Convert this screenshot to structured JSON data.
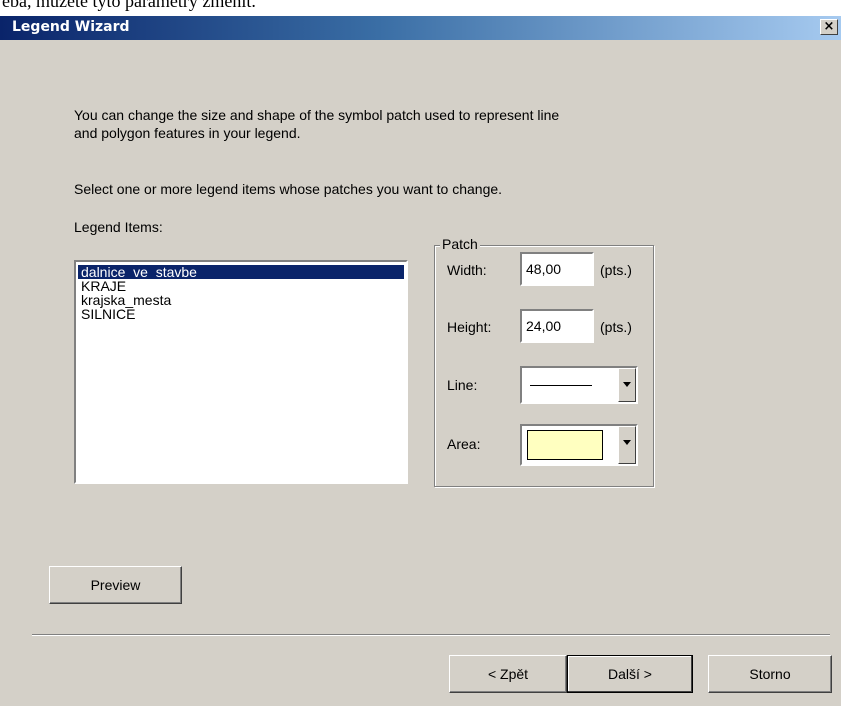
{
  "background_doc_text": "eba, můžete tyto parametry změnit.",
  "window": {
    "title": "Legend Wizard",
    "close_symbol": "×"
  },
  "instructions": {
    "line1": "You can change the size and shape of the symbol patch used to represent line",
    "line2": "and polygon features in your legend.",
    "select_prompt": "Select one or more legend items whose patches you want to change."
  },
  "legend_items": {
    "label": "Legend Items:",
    "items": [
      {
        "label": "dalnice_ve_stavbe",
        "selected": true
      },
      {
        "label": "KRAJE",
        "selected": false
      },
      {
        "label": "krajska_mesta",
        "selected": false
      },
      {
        "label": "SILNICE",
        "selected": false
      }
    ]
  },
  "patch": {
    "group_label": "Patch",
    "width_label": "Width:",
    "width_value": "48,00",
    "width_unit": "(pts.)",
    "height_label": "Height:",
    "height_value": "24,00",
    "height_unit": "(pts.)",
    "line_label": "Line:",
    "area_label": "Area:",
    "area_color": "#ffffc0"
  },
  "buttons": {
    "preview": "Preview",
    "back": "< Zpět",
    "next": "Další >",
    "cancel": "Storno"
  },
  "colors": {
    "title_bar": "#0a246a",
    "selection": "#0a246a",
    "dialog_face": "#d4d0c8"
  },
  "icons": {
    "close": "close-icon",
    "dropdown": "chevron-down-icon"
  }
}
